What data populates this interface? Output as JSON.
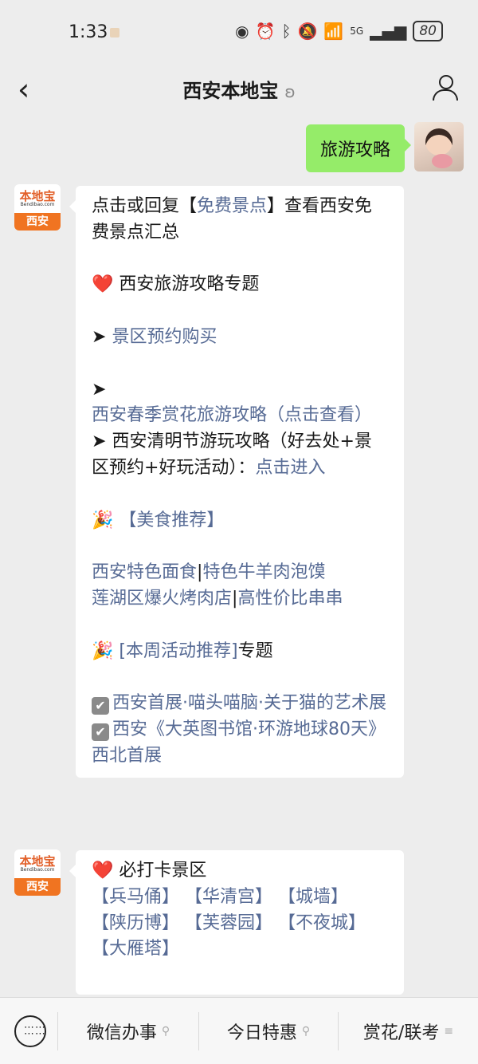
{
  "status_bar": {
    "time": "1:33",
    "network": "5G",
    "battery": "80"
  },
  "header": {
    "title": "西安本地宝"
  },
  "outgoing_message": "旅游攻略",
  "bot": {
    "logo_text": "本地宝",
    "logo_sub": "Bendibao.com",
    "band_text": "西安"
  },
  "message1": {
    "l1": "点击或回复【",
    "l1_link": "免费景点",
    "l1_b": "】查看西安免费景点汇总",
    "heart1": "❤️",
    "l2": " 西安旅游攻略专题",
    "arrow": "➤ ",
    "l3_link": "景区预约购买",
    "l4_link": "西安春季赏花旅游攻略（点击查看）",
    "l5": "西安清明节游玩攻略（好去处+景区预约+好玩活动）：",
    "l5_link": "点击进入",
    "party": "🎉",
    "l6_link": "【美食推荐】",
    "l7_a": "西安特色面食",
    "l7_sep": "|",
    "l7_b": "特色牛羊肉泡馍",
    "l8_a": "莲湖区爆火烤肉店",
    "l8_sep": "|",
    "l8_b": "高性价比串串",
    "l9_link": "[本周活动推荐]",
    "l9": "专题",
    "l10_link": "西安首展·喵头喵脑·关于猫的艺术展",
    "l11_link": "西安《大英图书馆·环游地球80天》西北首展",
    "check": "✔"
  },
  "message2": {
    "l1": " 必打卡景区",
    "spots": [
      "【兵马俑】",
      "【华清宫】",
      "【城墙】",
      "【陕历博】",
      "【芙蓉园】",
      "【不夜城】",
      "【大雁塔】"
    ]
  },
  "bottom_menu": {
    "item1": "微信办事",
    "item2": "今日特惠",
    "item3": "赏花/联考"
  }
}
